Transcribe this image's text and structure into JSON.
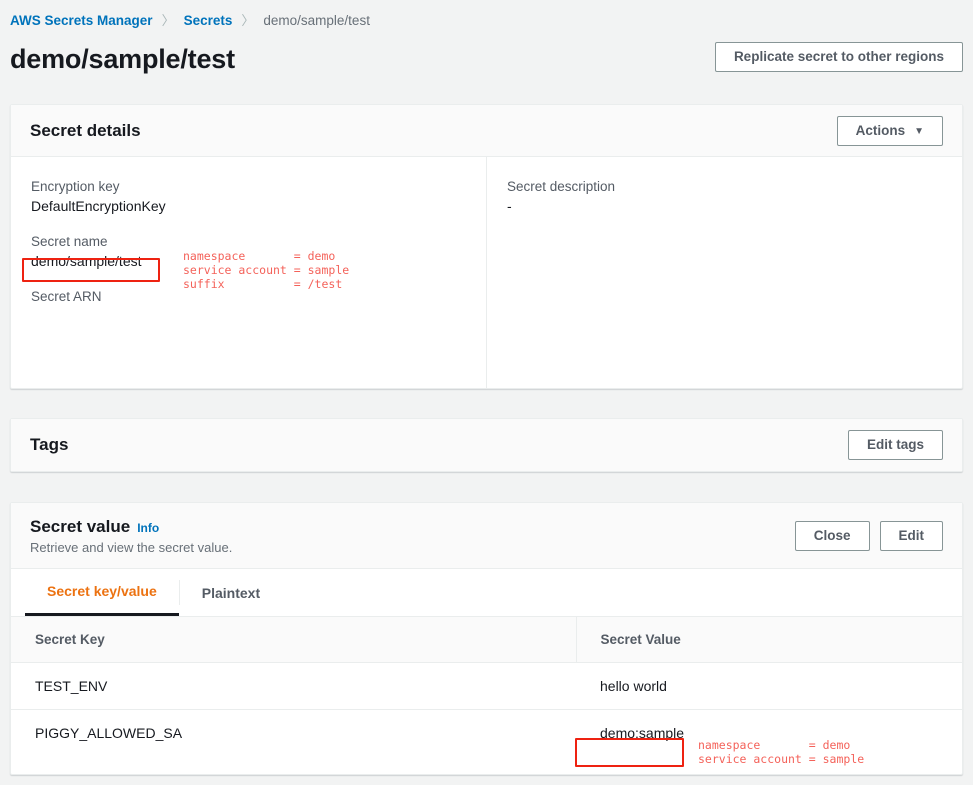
{
  "breadcrumb": {
    "items": [
      {
        "label": "AWS Secrets Manager",
        "type": "link"
      },
      {
        "label": "Secrets",
        "type": "link"
      },
      {
        "label": "demo/sample/test",
        "type": "current"
      }
    ],
    "separator": "〉"
  },
  "page": {
    "title": "demo/sample/test",
    "replicate_button": "Replicate secret to other regions"
  },
  "secret_details": {
    "title": "Secret details",
    "actions_button": "Actions",
    "actions_caret": "▼",
    "encryption_key_label": "Encryption key",
    "encryption_key_value": "DefaultEncryptionKey",
    "secret_name_label": "Secret name",
    "secret_name_value": "demo/sample/test",
    "secret_arn_label": "Secret ARN",
    "secret_arn_value": "",
    "secret_description_label": "Secret description",
    "secret_description_value": "-"
  },
  "tags": {
    "title": "Tags",
    "edit_button": "Edit tags"
  },
  "secret_value": {
    "title": "Secret value",
    "info_link": "Info",
    "subtitle": "Retrieve and view the secret value.",
    "close_button": "Close",
    "edit_button": "Edit",
    "tabs": [
      {
        "label": "Secret key/value",
        "active": true
      },
      {
        "label": "Plaintext",
        "active": false
      }
    ],
    "table": {
      "columns": [
        "Secret Key",
        "Secret Value"
      ],
      "rows": [
        {
          "key": "TEST_ENV",
          "value": "hello world"
        },
        {
          "key": "PIGGY_ALLOWED_SA",
          "value": "demo:sample"
        }
      ]
    }
  },
  "annotations": {
    "secret_name": "namespace       = demo\nservice account = sample\nsuffix          = /test",
    "secret_value": "namespace       = demo\nservice account = sample"
  },
  "colors": {
    "link": "#0073bb",
    "accent_orange": "#ec7211",
    "annotation_red": "#f4625a",
    "highlight_red": "#ee2211",
    "page_background": "#f2f3f3"
  }
}
